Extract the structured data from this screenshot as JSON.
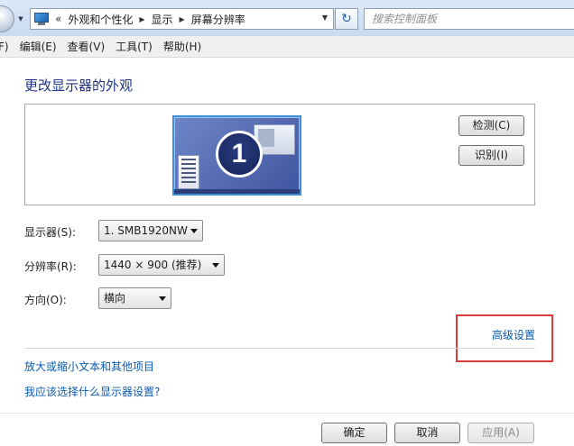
{
  "address_bar": {
    "overflow_marker": "«",
    "breadcrumbs": [
      "外观和个性化",
      "显示",
      "屏幕分辨率"
    ],
    "search_placeholder": "搜索控制面板"
  },
  "menu": {
    "items": [
      "F)",
      "编辑(E)",
      "查看(V)",
      "工具(T)",
      "帮助(H)"
    ]
  },
  "main": {
    "title": "更改显示器的外观",
    "monitor_number": "1",
    "detect_button": "检测(C)",
    "identify_button": "识别(I)",
    "fields": {
      "display_label": "显示器(S):",
      "display_value": "1. SMB1920NW",
      "resolution_label": "分辨率(R):",
      "resolution_value": "1440 × 900 (推荐)",
      "orientation_label": "方向(O):",
      "orientation_value": "横向"
    },
    "advanced_link": "高级设置",
    "text_size_link": "放大或缩小文本和其他项目",
    "which_settings_link": "我应该选择什么显示器设置?"
  },
  "footer": {
    "ok_button": "确定",
    "cancel_button": "取消",
    "apply_button": "应用(A)"
  },
  "colors": {
    "highlight_border": "#dc3c3c",
    "link": "#0b5cad",
    "title": "#1e3287"
  }
}
